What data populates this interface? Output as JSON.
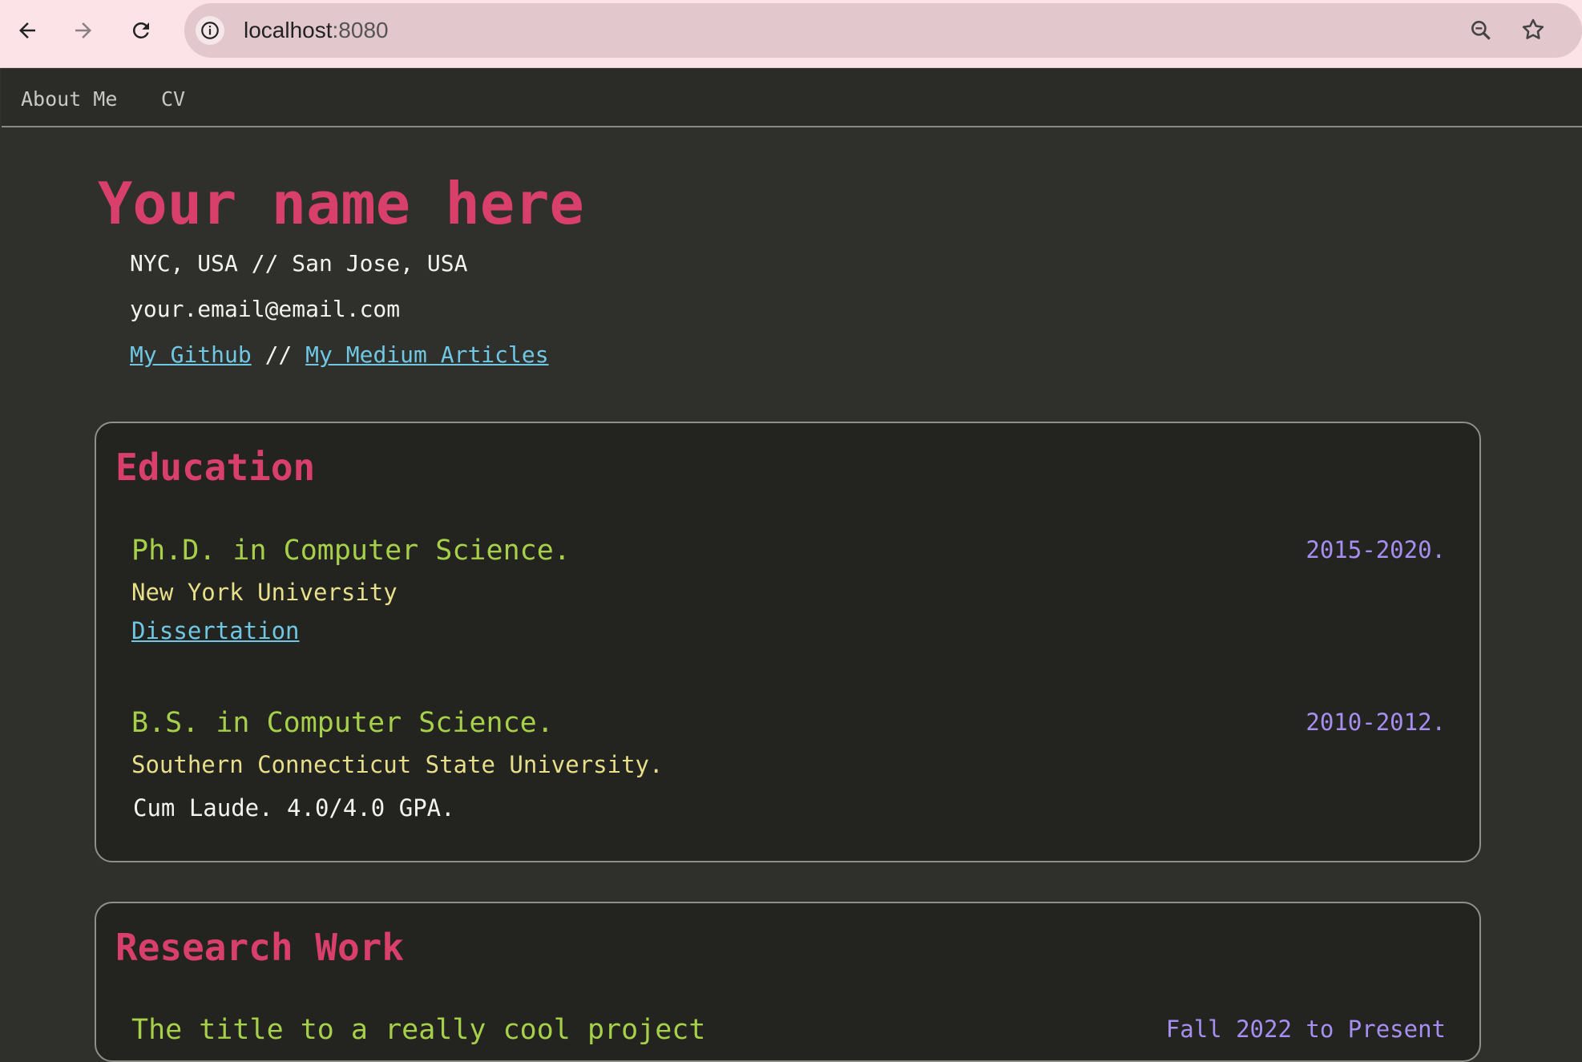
{
  "browser": {
    "url_host": "localhost",
    "url_port": ":8080"
  },
  "nav": {
    "items": [
      "About Me",
      "CV"
    ]
  },
  "header": {
    "name": "Your name here",
    "location": "NYC, USA // San Jose, USA",
    "email": "your.email@email.com",
    "github_label": "My Github",
    "separator": "//",
    "medium_label": "My Medium Articles"
  },
  "education": {
    "title": "Education",
    "entries": [
      {
        "degree": "Ph.D. in Computer Science.",
        "dates": "2015-2020.",
        "school": "New York University",
        "link": "Dissertation"
      },
      {
        "degree": "B.S. in Computer Science.",
        "dates": "2010-2012.",
        "school": "Southern Connecticut State University.",
        "note": "Cum Laude. 4.0/4.0 GPA."
      }
    ]
  },
  "research": {
    "title": "Research Work",
    "entries": [
      {
        "project": "The title to a really cool project",
        "dates": "Fall 2022 to Present"
      }
    ]
  },
  "colors": {
    "accent": "#d93f6b",
    "title_green": "#a6d04a",
    "date_purple": "#a68ff0",
    "org_yellow": "#e7df8a",
    "link_blue": "#70c7e3",
    "background": "#2f302b",
    "card": "#23231f"
  }
}
